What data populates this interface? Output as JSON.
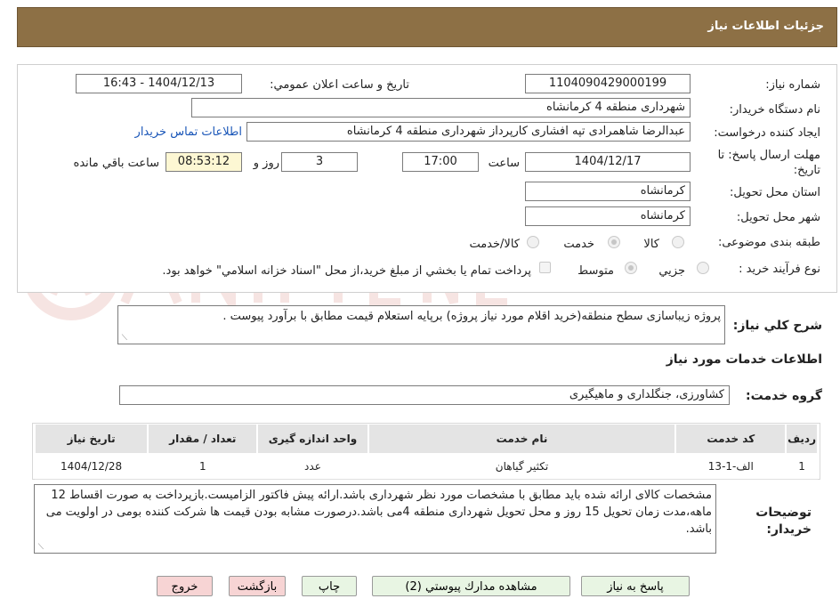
{
  "header": {
    "title": "جزئيات اطلاعات نياز"
  },
  "fields": {
    "need_number_label": "شماره نياز:",
    "need_number": "1104090429000199",
    "announce_label": "تاريخ و ساعت اعلان عمومي:",
    "announce_value": "1404/12/13 - 16:43",
    "buyer_org_label": "نام دستگاه خريدار:",
    "buyer_org": "شهرداری منطقه 4 کرمانشاه",
    "requester_label": "ايجاد كننده درخواست:",
    "requester": "عبدالرضا شاهمرادی تپه افشاری کارپرداز شهرداری منطقه 4 کرمانشاه",
    "contact_link": "اطلاعات تماس خريدار",
    "deadline_label": "مهلت ارسال پاسخ: تا تاريخ:",
    "deadline_date": "1404/12/17",
    "time_label": "ساعت",
    "deadline_time": "17:00",
    "days_value": "3",
    "days_label": "روز و",
    "remaining_time": "08:53:12",
    "remaining_label": "ساعت باقي مانده",
    "province_label": "استان محل تحويل:",
    "province": "کرمانشاه",
    "city_label": "شهر محل تحويل:",
    "city": "کرمانشاه",
    "category_label": "طبقه بندی موضوعی:",
    "category_options": [
      "كالا",
      "خدمت",
      "كالا/خدمت"
    ],
    "process_label": "نوع فرآيند خريد :",
    "process_options": [
      "جزيي",
      "متوسط"
    ],
    "payment_note": "پرداخت تمام يا بخشي از مبلغ خريد،از محل \"اسناد خزانه اسلامي\" خواهد بود."
  },
  "summary": {
    "label": "شرح كلي نياز:",
    "text": "پروژه زیباسازی سطح منطقه(خرید اقلام مورد نیاز پروژه) برپایه استعلام قیمت مطابق با برآورد پیوست ."
  },
  "services": {
    "title": "اطلاعات خدمات مورد نياز",
    "group_label": "گروه خدمت:",
    "group_value": "کشاورزی، جنگلداری و ماهیگیری",
    "columns": [
      "رديف",
      "كد خدمت",
      "نام خدمت",
      "واحد اندازه گيری",
      "تعداد / مقدار",
      "تاريخ نياز"
    ],
    "rows": [
      [
        "1",
        "الف-1-13",
        "تکثیر گیاهان",
        "عدد",
        "1",
        "1404/12/28"
      ]
    ]
  },
  "buyer_notes": {
    "label": "توضيحات خريدار:",
    "text": "مشخصات کالای ارائه شده باید مطابق با مشخصات مورد نظر شهرداری باشد.ارائه پیش فاکتور الزامیست.بازپرداخت به صورت اقساط 12 ماهه،مدت زمان تحویل 15 روز و محل تحویل شهرداری منطقه 4می باشد.درصورت مشابه بودن قیمت ها شرکت کننده بومی در اولویت می باشد."
  },
  "buttons": {
    "reply": "پاسخ به نياز",
    "attachments": "مشاهده مدارك پيوستي (2)",
    "print": "چاپ",
    "back": "بازگشت",
    "exit": "خروج"
  },
  "colors": {
    "header_bg": "#8d7045",
    "link": "#1a56b8",
    "button_green": "#e8f5e3",
    "button_red": "#f7d4d4",
    "remaining_bg": "#fdf7d3"
  }
}
